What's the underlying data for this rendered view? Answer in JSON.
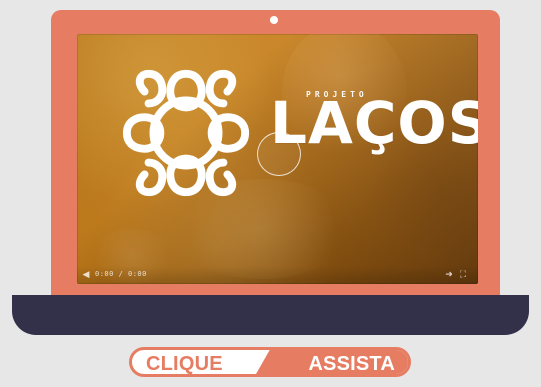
{
  "screen": {
    "brand_kicker": "PROJETO",
    "brand_title": "LAÇOS",
    "time_text": "0:00 / 0:00",
    "colors": {
      "laptop_lid": "#e67d62",
      "laptop_base": "#33304a",
      "video_tint": "#c77f1a",
      "white": "#ffffff"
    },
    "icons": {
      "logo": "knot-logo-icon",
      "play": "play-circle-icon",
      "volume": "volume-icon",
      "fullscreen": "fullscreen-icon"
    }
  },
  "cta": {
    "left_label": "CLIQUE",
    "right_label": "ASSISTA"
  }
}
